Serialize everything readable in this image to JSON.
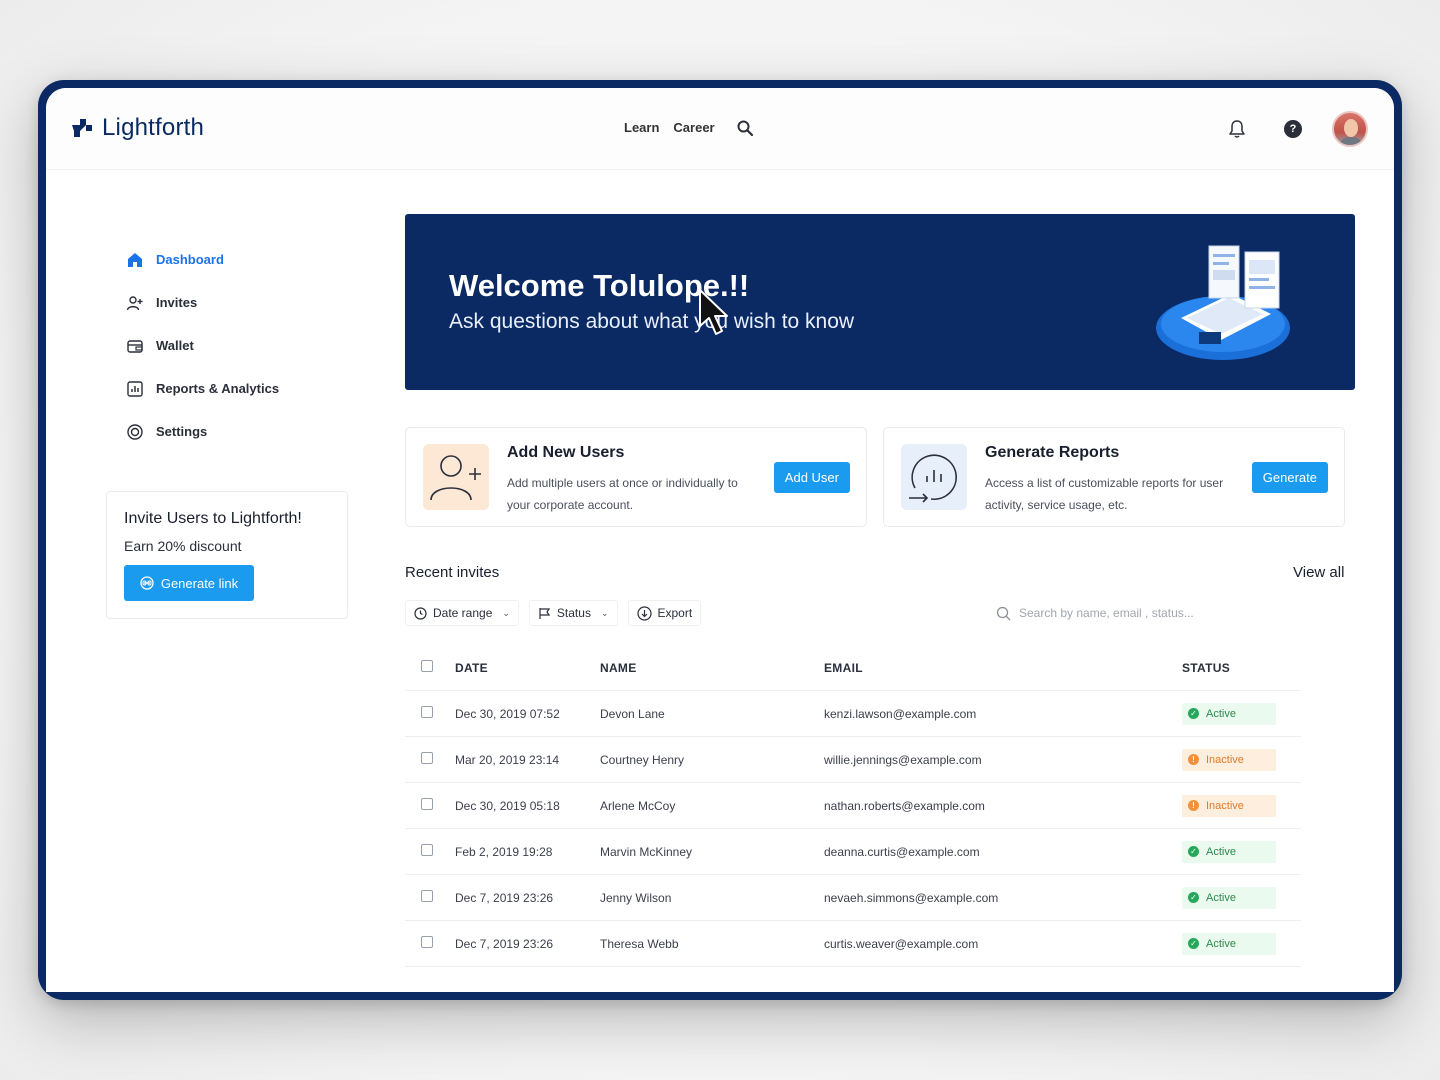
{
  "header": {
    "brand": "Lightforth",
    "nav": [
      "Learn",
      "Career"
    ]
  },
  "sidebar": {
    "items": [
      {
        "label": "Dashboard",
        "icon": "home-icon",
        "active": true
      },
      {
        "label": "Invites",
        "icon": "user-plus-icon"
      },
      {
        "label": "Wallet",
        "icon": "wallet-icon"
      },
      {
        "label": "Reports & Analytics",
        "icon": "chart-icon"
      },
      {
        "label": "Settings",
        "icon": "gear-icon"
      }
    ],
    "invite_card": {
      "title": "Invite Users to Lightforth!",
      "subtitle": "Earn 20% discount",
      "button": "Generate link"
    }
  },
  "banner": {
    "title": "Welcome Tolulope.!!",
    "subtitle": "Ask questions about what you wish to know"
  },
  "cards": [
    {
      "title": "Add New Users",
      "desc": "Add multiple users at once or individually to your corporate account.",
      "button": "Add User"
    },
    {
      "title": "Generate Reports",
      "desc": "Access a list of customizable reports for user activity, service usage, etc.",
      "button": "Generate"
    }
  ],
  "recent": {
    "title": "Recent invites",
    "view_all": "View all",
    "filters": {
      "date": "Date range",
      "status": "Status",
      "export": "Export"
    },
    "search_placeholder": "Search by name, email , status...",
    "columns": {
      "date": "DATE",
      "name": "NAME",
      "email": "EMAIL",
      "status": "STATUS"
    },
    "rows": [
      {
        "date": "Dec 30, 2019 07:52",
        "name": "Devon Lane",
        "email": "kenzi.lawson@example.com",
        "status": "Active"
      },
      {
        "date": "Mar 20, 2019 23:14",
        "name": "Courtney Henry",
        "email": "willie.jennings@example.com",
        "status": "Inactive"
      },
      {
        "date": "Dec 30, 2019 05:18",
        "name": "Arlene McCoy",
        "email": "nathan.roberts@example.com",
        "status": "Inactive"
      },
      {
        "date": "Feb 2, 2019 19:28",
        "name": "Marvin McKinney",
        "email": "deanna.curtis@example.com",
        "status": "Active"
      },
      {
        "date": "Dec 7, 2019 23:26",
        "name": "Jenny Wilson",
        "email": "nevaeh.simmons@example.com",
        "status": "Active"
      },
      {
        "date": "Dec 7, 2019 23:26",
        "name": "Theresa Webb",
        "email": "curtis.weaver@example.com",
        "status": "Active"
      }
    ]
  },
  "colors": {
    "brand_navy": "#0b2a63",
    "primary_blue": "#1a9bf0",
    "active_green": "#27a75a",
    "inactive_orange": "#f0913d"
  }
}
